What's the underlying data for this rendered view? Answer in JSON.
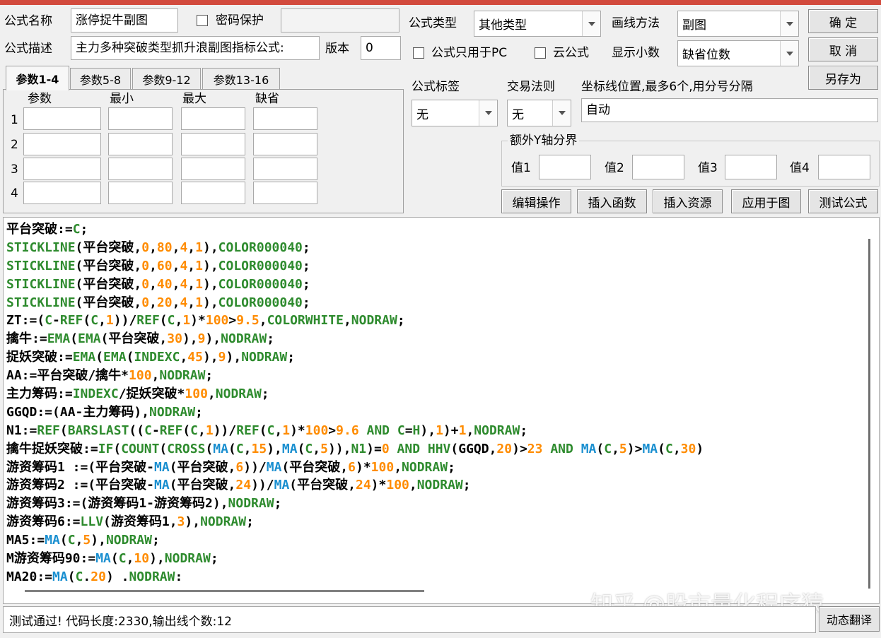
{
  "header": {
    "name_label": "公式名称",
    "name_value": "涨停捉牛副图",
    "password_label": "密码保护",
    "password_value": "",
    "desc_label": "公式描述",
    "desc_value": "主力多种突破类型抓升浪副图指标公式:",
    "version_label": "版本",
    "version_value": "0",
    "type_label": "公式类型",
    "type_value": "其他类型",
    "draw_label": "画线方法",
    "draw_value": "副图",
    "pc_only_label": "公式只用于PC",
    "cloud_label": "云公式",
    "decimal_label": "显示小数",
    "decimal_value": "缺省位数"
  },
  "buttons": {
    "ok": "确  定",
    "cancel": "取  消",
    "save_as": "另存为",
    "edit_ops": "编辑操作",
    "insert_func": "插入函数",
    "insert_res": "插入资源",
    "apply": "应用于图",
    "test": "测试公式",
    "dynamic_translate": "动态翻译"
  },
  "tabs": [
    "参数1-4",
    "参数5-8",
    "参数9-12",
    "参数13-16"
  ],
  "params": {
    "columns": [
      "参数",
      "最小",
      "最大",
      "缺省"
    ],
    "rows": [
      "1",
      "2",
      "3",
      "4"
    ]
  },
  "tags": {
    "tag_label": "公式标签",
    "tag_value": "无",
    "rule_label": "交易法则",
    "rule_value": "无",
    "axis_label": "坐标线位置,最多6个,用分号分隔",
    "axis_value": "自动"
  },
  "yaxis": {
    "group_label": "额外Y轴分界",
    "v1": "值1",
    "v2": "值2",
    "v3": "值3",
    "v4": "值4"
  },
  "code": [
    [
      [
        "k",
        "平台突破:="
      ],
      [
        "f",
        "C"
      ],
      [
        "k",
        ";"
      ]
    ],
    [
      [
        "f",
        "STICKLINE"
      ],
      [
        "k",
        "(平台突破,"
      ],
      [
        "n",
        "0"
      ],
      [
        "k",
        ","
      ],
      [
        "n",
        "80"
      ],
      [
        "k",
        ","
      ],
      [
        "n",
        "4"
      ],
      [
        "k",
        ","
      ],
      [
        "n",
        "1"
      ],
      [
        "k",
        "),"
      ],
      [
        "f",
        "COLOR000040"
      ],
      [
        "k",
        ";"
      ]
    ],
    [
      [
        "f",
        "STICKLINE"
      ],
      [
        "k",
        "(平台突破,"
      ],
      [
        "n",
        "0"
      ],
      [
        "k",
        ","
      ],
      [
        "n",
        "60"
      ],
      [
        "k",
        ","
      ],
      [
        "n",
        "4"
      ],
      [
        "k",
        ","
      ],
      [
        "n",
        "1"
      ],
      [
        "k",
        "),"
      ],
      [
        "f",
        "COLOR000040"
      ],
      [
        "k",
        ";"
      ]
    ],
    [
      [
        "f",
        "STICKLINE"
      ],
      [
        "k",
        "(平台突破,"
      ],
      [
        "n",
        "0"
      ],
      [
        "k",
        ","
      ],
      [
        "n",
        "40"
      ],
      [
        "k",
        ","
      ],
      [
        "n",
        "4"
      ],
      [
        "k",
        ","
      ],
      [
        "n",
        "1"
      ],
      [
        "k",
        "),"
      ],
      [
        "f",
        "COLOR000040"
      ],
      [
        "k",
        ";"
      ]
    ],
    [
      [
        "f",
        "STICKLINE"
      ],
      [
        "k",
        "(平台突破,"
      ],
      [
        "n",
        "0"
      ],
      [
        "k",
        ","
      ],
      [
        "n",
        "20"
      ],
      [
        "k",
        ","
      ],
      [
        "n",
        "4"
      ],
      [
        "k",
        ","
      ],
      [
        "n",
        "1"
      ],
      [
        "k",
        "),"
      ],
      [
        "f",
        "COLOR000040"
      ],
      [
        "k",
        ";"
      ]
    ],
    [
      [
        "k",
        "ZT:=("
      ],
      [
        "f",
        "C"
      ],
      [
        "k",
        "-"
      ],
      [
        "f",
        "REF"
      ],
      [
        "k",
        "("
      ],
      [
        "f",
        "C"
      ],
      [
        "k",
        ","
      ],
      [
        "n",
        "1"
      ],
      [
        "k",
        "))/"
      ],
      [
        "f",
        "REF"
      ],
      [
        "k",
        "("
      ],
      [
        "f",
        "C"
      ],
      [
        "k",
        ","
      ],
      [
        "n",
        "1"
      ],
      [
        "k",
        ")*"
      ],
      [
        "n",
        "100"
      ],
      [
        "k",
        ">"
      ],
      [
        "n",
        "9.5"
      ],
      [
        "k",
        ","
      ],
      [
        "f",
        "COLORWHITE"
      ],
      [
        "k",
        ","
      ],
      [
        "f",
        "NODRAW"
      ],
      [
        "k",
        ";"
      ]
    ],
    [
      [
        "k",
        "擒牛:="
      ],
      [
        "f",
        "EMA"
      ],
      [
        "k",
        "("
      ],
      [
        "f",
        "EMA"
      ],
      [
        "k",
        "(平台突破,"
      ],
      [
        "n",
        "30"
      ],
      [
        "k",
        "),"
      ],
      [
        "n",
        "9"
      ],
      [
        "k",
        "),"
      ],
      [
        "f",
        "NODRAW"
      ],
      [
        "k",
        ";"
      ]
    ],
    [
      [
        "k",
        "捉妖突破:="
      ],
      [
        "f",
        "EMA"
      ],
      [
        "k",
        "("
      ],
      [
        "f",
        "EMA"
      ],
      [
        "k",
        "("
      ],
      [
        "f",
        "INDEXC"
      ],
      [
        "k",
        ","
      ],
      [
        "n",
        "45"
      ],
      [
        "k",
        "),"
      ],
      [
        "n",
        "9"
      ],
      [
        "k",
        "),"
      ],
      [
        "f",
        "NODRAW"
      ],
      [
        "k",
        ";"
      ]
    ],
    [
      [
        "k",
        "AA:=平台突破/擒牛*"
      ],
      [
        "n",
        "100"
      ],
      [
        "k",
        ","
      ],
      [
        "f",
        "NODRAW"
      ],
      [
        "k",
        ";"
      ]
    ],
    [
      [
        "k",
        "主力筹码:="
      ],
      [
        "f",
        "INDEXC"
      ],
      [
        "k",
        "/捉妖突破*"
      ],
      [
        "n",
        "100"
      ],
      [
        "k",
        ","
      ],
      [
        "f",
        "NODRAW"
      ],
      [
        "k",
        ";"
      ]
    ],
    [
      [
        "k",
        "GGQD:=(AA-主力筹码),"
      ],
      [
        "f",
        "NODRAW"
      ],
      [
        "k",
        ";"
      ]
    ],
    [
      [
        "k",
        "N1:="
      ],
      [
        "f",
        "REF"
      ],
      [
        "k",
        "("
      ],
      [
        "f",
        "BARSLAST"
      ],
      [
        "k",
        "(("
      ],
      [
        "f",
        "C"
      ],
      [
        "k",
        "-"
      ],
      [
        "f",
        "REF"
      ],
      [
        "k",
        "("
      ],
      [
        "f",
        "C"
      ],
      [
        "k",
        ","
      ],
      [
        "n",
        "1"
      ],
      [
        "k",
        "))/"
      ],
      [
        "f",
        "REF"
      ],
      [
        "k",
        "("
      ],
      [
        "f",
        "C"
      ],
      [
        "k",
        ","
      ],
      [
        "n",
        "1"
      ],
      [
        "k",
        ")*"
      ],
      [
        "n",
        "100"
      ],
      [
        "k",
        ">"
      ],
      [
        "n",
        "9.6"
      ],
      [
        "k",
        " "
      ],
      [
        "f",
        "AND"
      ],
      [
        "k",
        " "
      ],
      [
        "f",
        "C"
      ],
      [
        "k",
        "="
      ],
      [
        "f",
        "H"
      ],
      [
        "k",
        "),"
      ],
      [
        "n",
        "1"
      ],
      [
        "k",
        ")+"
      ],
      [
        "n",
        "1"
      ],
      [
        "k",
        ","
      ],
      [
        "f",
        "NODRAW"
      ],
      [
        "k",
        ";"
      ]
    ],
    [
      [
        "k",
        "擒牛捉妖突破:="
      ],
      [
        "f",
        "IF"
      ],
      [
        "k",
        "("
      ],
      [
        "f",
        "COUNT"
      ],
      [
        "k",
        "("
      ],
      [
        "f",
        "CROSS"
      ],
      [
        "k",
        "("
      ],
      [
        "b",
        "MA"
      ],
      [
        "k",
        "("
      ],
      [
        "f",
        "C"
      ],
      [
        "k",
        ","
      ],
      [
        "n",
        "15"
      ],
      [
        "k",
        "),"
      ],
      [
        "b",
        "MA"
      ],
      [
        "k",
        "("
      ],
      [
        "f",
        "C"
      ],
      [
        "k",
        ","
      ],
      [
        "n",
        "5"
      ],
      [
        "k",
        ")),"
      ],
      [
        "f",
        "N1"
      ],
      [
        "k",
        ")="
      ],
      [
        "n",
        "0"
      ],
      [
        "k",
        " "
      ],
      [
        "f",
        "AND"
      ],
      [
        "k",
        " "
      ],
      [
        "f",
        "HHV"
      ],
      [
        "k",
        "(GGQD,"
      ],
      [
        "n",
        "20"
      ],
      [
        "k",
        ")>"
      ],
      [
        "n",
        "23"
      ],
      [
        "k",
        " "
      ],
      [
        "f",
        "AND"
      ],
      [
        "k",
        " "
      ],
      [
        "b",
        "MA"
      ],
      [
        "k",
        "("
      ],
      [
        "f",
        "C"
      ],
      [
        "k",
        ","
      ],
      [
        "n",
        "5"
      ],
      [
        "k",
        ")>"
      ],
      [
        "b",
        "MA"
      ],
      [
        "k",
        "("
      ],
      [
        "f",
        "C"
      ],
      [
        "k",
        ","
      ],
      [
        "n",
        "30"
      ],
      [
        "k",
        ")"
      ]
    ],
    [
      [
        "k",
        "游资筹码1 :=(平台突破-"
      ],
      [
        "b",
        "MA"
      ],
      [
        "k",
        "(平台突破,"
      ],
      [
        "n",
        "6"
      ],
      [
        "k",
        "))/"
      ],
      [
        "b",
        "MA"
      ],
      [
        "k",
        "(平台突破,"
      ],
      [
        "n",
        "6"
      ],
      [
        "k",
        ")*"
      ],
      [
        "n",
        "100"
      ],
      [
        "k",
        ","
      ],
      [
        "f",
        "NODRAW"
      ],
      [
        "k",
        ";"
      ]
    ],
    [
      [
        "k",
        "游资筹码2 :=(平台突破-"
      ],
      [
        "b",
        "MA"
      ],
      [
        "k",
        "(平台突破,"
      ],
      [
        "n",
        "24"
      ],
      [
        "k",
        "))/"
      ],
      [
        "b",
        "MA"
      ],
      [
        "k",
        "(平台突破,"
      ],
      [
        "n",
        "24"
      ],
      [
        "k",
        ")*"
      ],
      [
        "n",
        "100"
      ],
      [
        "k",
        ","
      ],
      [
        "f",
        "NODRAW"
      ],
      [
        "k",
        ";"
      ]
    ],
    [
      [
        "k",
        "游资筹码3:=(游资筹码1-游资筹码2),"
      ],
      [
        "f",
        "NODRAW"
      ],
      [
        "k",
        ";"
      ]
    ],
    [
      [
        "k",
        "游资筹码6:="
      ],
      [
        "f",
        "LLV"
      ],
      [
        "k",
        "(游资筹码1,"
      ],
      [
        "n",
        "3"
      ],
      [
        "k",
        "),"
      ],
      [
        "f",
        "NODRAW"
      ],
      [
        "k",
        ";"
      ]
    ],
    [
      [
        "k",
        "MA5:="
      ],
      [
        "b",
        "MA"
      ],
      [
        "k",
        "("
      ],
      [
        "f",
        "C"
      ],
      [
        "k",
        ","
      ],
      [
        "n",
        "5"
      ],
      [
        "k",
        "),"
      ],
      [
        "f",
        "NODRAW"
      ],
      [
        "k",
        ";"
      ]
    ],
    [
      [
        "k",
        "M游资筹码90:="
      ],
      [
        "b",
        "MA"
      ],
      [
        "k",
        "("
      ],
      [
        "f",
        "C"
      ],
      [
        "k",
        ","
      ],
      [
        "n",
        "10"
      ],
      [
        "k",
        "),"
      ],
      [
        "f",
        "NODRAW"
      ],
      [
        "k",
        ";"
      ]
    ],
    [
      [
        "k",
        "MA20:="
      ],
      [
        "b",
        "MA"
      ],
      [
        "k",
        "("
      ],
      [
        "f",
        "C"
      ],
      [
        "k",
        "."
      ],
      [
        "n",
        "20"
      ],
      [
        "k",
        ") ."
      ],
      [
        "f",
        "NODRAW"
      ],
      [
        "k",
        ":"
      ]
    ]
  ],
  "status": "测试通过! 代码长度:2330,输出线个数:12",
  "watermark": "知乎 @股市量化程序猿"
}
